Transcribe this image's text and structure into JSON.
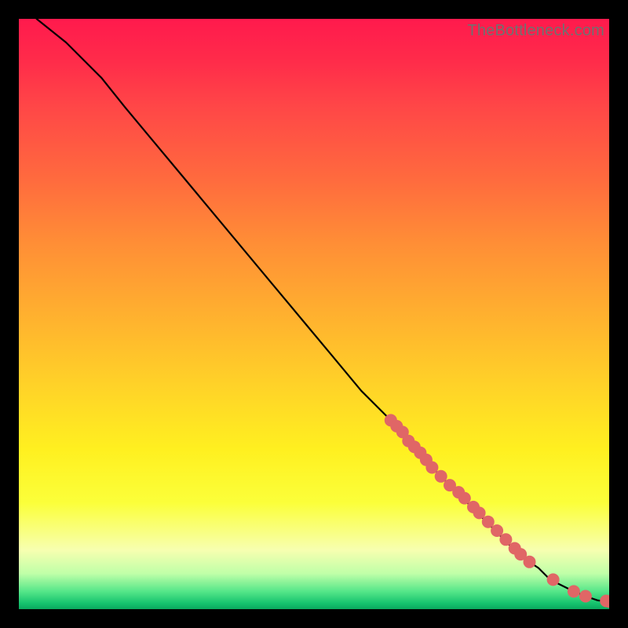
{
  "watermark": "TheBottleneck.com",
  "chart_data": {
    "type": "line",
    "title": "",
    "xlabel": "",
    "ylabel": "",
    "xlim": [
      0,
      100
    ],
    "ylim": [
      0,
      100
    ],
    "grid": false,
    "line": {
      "x": [
        3,
        8,
        14,
        18,
        23,
        28,
        33,
        38,
        43,
        48,
        53,
        58,
        63,
        66,
        70,
        73,
        76,
        79,
        82,
        85,
        88,
        90,
        92,
        94,
        96,
        98,
        100
      ],
      "y": [
        100,
        96,
        90,
        85,
        79,
        73,
        67,
        61,
        55,
        49,
        43,
        37,
        32,
        28,
        24,
        21,
        18,
        15,
        12,
        9,
        7,
        5,
        4,
        3,
        2.2,
        1.5,
        1.2
      ]
    },
    "markers": {
      "note": "Clustered coral markers along the lower segment of the curve",
      "x": [
        63,
        64,
        65,
        66,
        67,
        68,
        69,
        70,
        71.5,
        73,
        74.5,
        75.5,
        77,
        78,
        79.5,
        81,
        82.5,
        84,
        85,
        86.5,
        90.5,
        94,
        96,
        99.5,
        100
      ],
      "y": [
        32,
        31,
        30,
        28.5,
        27.5,
        26.5,
        25.3,
        24,
        22.5,
        21,
        19.8,
        18.8,
        17.3,
        16.3,
        14.8,
        13.3,
        11.8,
        10.3,
        9.3,
        8,
        5,
        3,
        2.2,
        1.4,
        1.3
      ]
    },
    "colors": {
      "line": "#000000",
      "marker_fill": "#e06666",
      "marker_stroke": "#b84b4b"
    }
  }
}
